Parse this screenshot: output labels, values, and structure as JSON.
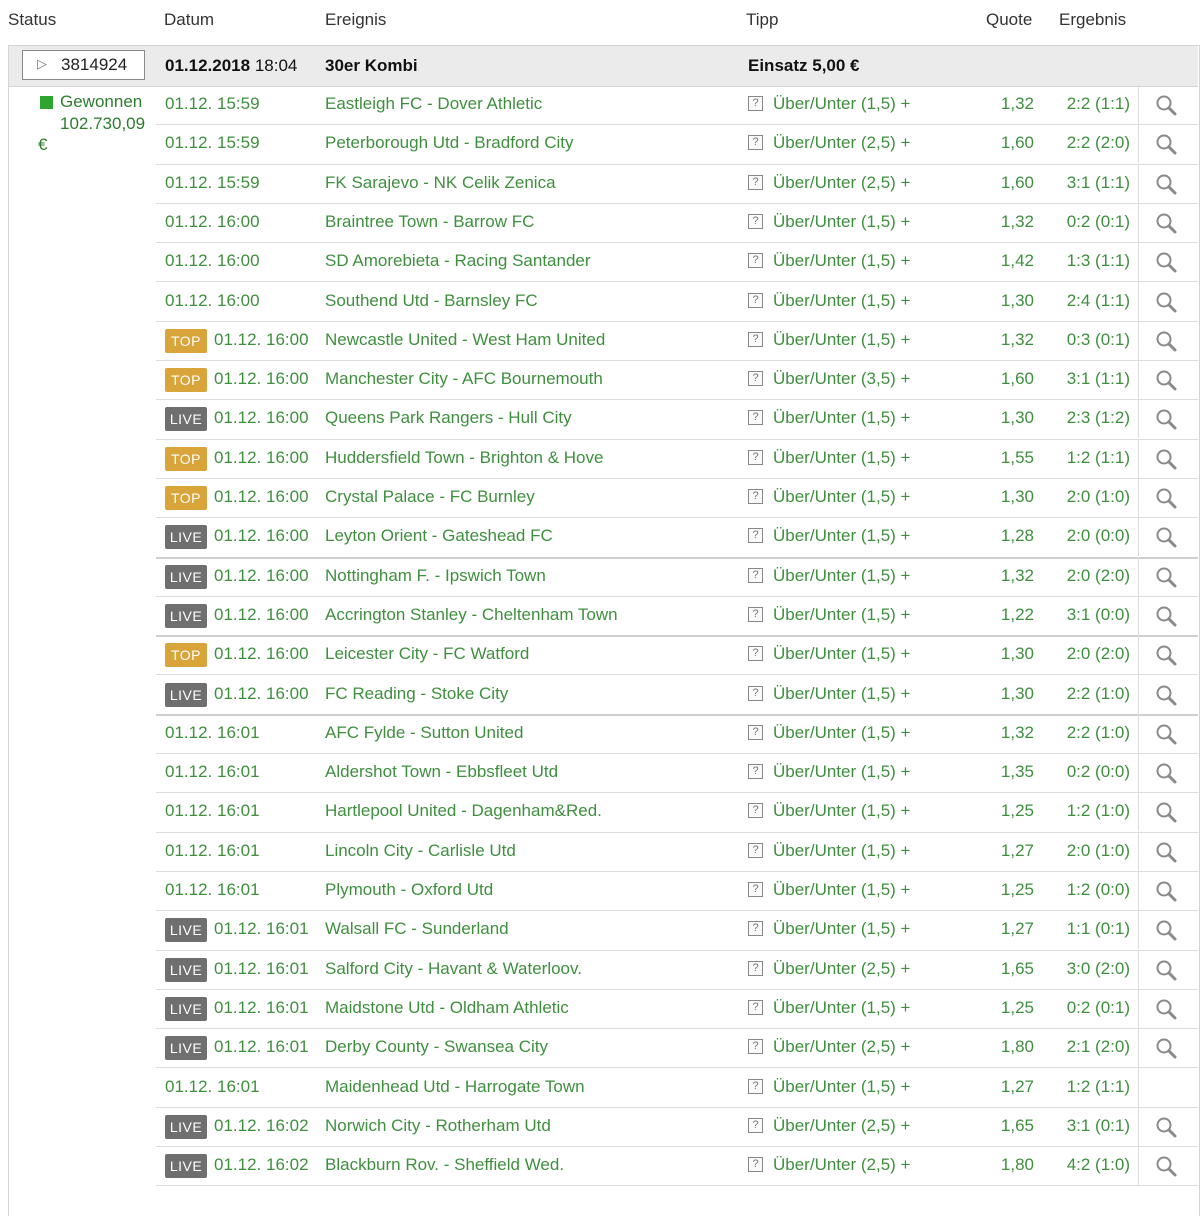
{
  "headers": {
    "status": "Status",
    "datum": "Datum",
    "ereignis": "Ereignis",
    "tipp": "Tipp",
    "quote": "Quote",
    "ergebnis": "Ergebnis"
  },
  "bet": {
    "id": "3814924",
    "date": "01.12.2018",
    "time": "18:04",
    "title": "30er Kombi",
    "stake": "Einsatz 5,00 €",
    "status": "Gewonnen",
    "payout": "102.730,09",
    "currency": "€"
  },
  "colors": {
    "accent_green": "#3f8f3f",
    "top_badge": "#d9a43a",
    "live_badge": "#6f6f6f",
    "status_won": "#2ea52e"
  },
  "rows": [
    {
      "badge": "",
      "date": "01.12. 15:59",
      "event": "Eastleigh FC - Dover Athletic",
      "tipp": "Über/Unter (1,5) +",
      "quote": "1,32",
      "result": "2:2 (1:1)",
      "search": true
    },
    {
      "badge": "",
      "date": "01.12. 15:59",
      "event": "Peterborough Utd - Bradford City",
      "tipp": "Über/Unter (2,5) +",
      "quote": "1,60",
      "result": "2:2 (2:0)",
      "search": true
    },
    {
      "badge": "",
      "date": "01.12. 15:59",
      "event": "FK Sarajevo - NK Celik Zenica",
      "tipp": "Über/Unter (2,5) +",
      "quote": "1,60",
      "result": "3:1 (1:1)",
      "search": true
    },
    {
      "badge": "",
      "date": "01.12. 16:00",
      "event": "Braintree Town - Barrow FC",
      "tipp": "Über/Unter (1,5) +",
      "quote": "1,32",
      "result": "0:2 (0:1)",
      "search": true
    },
    {
      "badge": "",
      "date": "01.12. 16:00",
      "event": "SD Amorebieta - Racing Santander",
      "tipp": "Über/Unter (1,5) +",
      "quote": "1,42",
      "result": "1:3 (1:1)",
      "search": true
    },
    {
      "badge": "",
      "date": "01.12. 16:00",
      "event": "Southend Utd - Barnsley FC",
      "tipp": "Über/Unter (1,5) +",
      "quote": "1,30",
      "result": "2:4 (1:1)",
      "search": true
    },
    {
      "badge": "TOP",
      "date": "01.12. 16:00",
      "event": "Newcastle United - West Ham United",
      "tipp": "Über/Unter (1,5) +",
      "quote": "1,32",
      "result": "0:3 (0:1)",
      "search": true
    },
    {
      "badge": "TOP",
      "date": "01.12. 16:00",
      "event": "Manchester City - AFC Bournemouth",
      "tipp": "Über/Unter (3,5) +",
      "quote": "1,60",
      "result": "3:1 (1:1)",
      "search": true
    },
    {
      "badge": "LIVE",
      "date": "01.12. 16:00",
      "event": "Queens Park Rangers - Hull City",
      "tipp": "Über/Unter (1,5) +",
      "quote": "1,30",
      "result": "2:3 (1:2)",
      "search": true
    },
    {
      "badge": "TOP",
      "date": "01.12. 16:00",
      "event": "Huddersfield Town - Brighton & Hove",
      "tipp": "Über/Unter (1,5) +",
      "quote": "1,55",
      "result": "1:2 (1:1)",
      "search": true
    },
    {
      "badge": "TOP",
      "date": "01.12. 16:00",
      "event": "Crystal Palace - FC Burnley",
      "tipp": "Über/Unter (1,5) +",
      "quote": "1,30",
      "result": "2:0 (1:0)",
      "search": true
    },
    {
      "badge": "LIVE",
      "date": "01.12. 16:00",
      "event": "Leyton Orient - Gateshead FC",
      "tipp": "Über/Unter (1,5) +",
      "quote": "1,28",
      "result": "2:0 (0:0)",
      "search": true
    },
    {
      "badge": "LIVE",
      "date": "01.12. 16:00",
      "event": "Nottingham F. - Ipswich Town",
      "tipp": "Über/Unter (1,5) +",
      "quote": "1,32",
      "result": "2:0 (2:0)",
      "search": true
    },
    {
      "badge": "LIVE",
      "date": "01.12. 16:00",
      "event": "Accrington Stanley - Cheltenham Town",
      "tipp": "Über/Unter (1,5) +",
      "quote": "1,22",
      "result": "3:1 (0:0)",
      "search": true
    },
    {
      "badge": "TOP",
      "date": "01.12. 16:00",
      "event": "Leicester City - FC Watford",
      "tipp": "Über/Unter (1,5) +",
      "quote": "1,30",
      "result": "2:0 (2:0)",
      "search": true
    },
    {
      "badge": "LIVE",
      "date": "01.12. 16:00",
      "event": "FC Reading - Stoke City",
      "tipp": "Über/Unter (1,5) +",
      "quote": "1,30",
      "result": "2:2 (1:0)",
      "search": true
    },
    {
      "badge": "",
      "date": "01.12. 16:01",
      "event": "AFC Fylde - Sutton United",
      "tipp": "Über/Unter (1,5) +",
      "quote": "1,32",
      "result": "2:2 (1:0)",
      "search": true
    },
    {
      "badge": "",
      "date": "01.12. 16:01",
      "event": "Aldershot Town - Ebbsfleet Utd",
      "tipp": "Über/Unter (1,5) +",
      "quote": "1,35",
      "result": "0:2 (0:0)",
      "search": true
    },
    {
      "badge": "",
      "date": "01.12. 16:01",
      "event": "Hartlepool United - Dagenham&Red.",
      "tipp": "Über/Unter (1,5) +",
      "quote": "1,25",
      "result": "1:2 (1:0)",
      "search": true
    },
    {
      "badge": "",
      "date": "01.12. 16:01",
      "event": "Lincoln City - Carlisle Utd",
      "tipp": "Über/Unter (1,5) +",
      "quote": "1,27",
      "result": "2:0 (1:0)",
      "search": true
    },
    {
      "badge": "",
      "date": "01.12. 16:01",
      "event": "Plymouth - Oxford Utd",
      "tipp": "Über/Unter (1,5) +",
      "quote": "1,25",
      "result": "1:2 (0:0)",
      "search": true
    },
    {
      "badge": "LIVE",
      "date": "01.12. 16:01",
      "event": "Walsall FC - Sunderland",
      "tipp": "Über/Unter (1,5) +",
      "quote": "1,27",
      "result": "1:1 (0:1)",
      "search": true
    },
    {
      "badge": "LIVE",
      "date": "01.12. 16:01",
      "event": "Salford City - Havant & Waterloov.",
      "tipp": "Über/Unter (2,5) +",
      "quote": "1,65",
      "result": "3:0 (2:0)",
      "search": true
    },
    {
      "badge": "LIVE",
      "date": "01.12. 16:01",
      "event": "Maidstone Utd - Oldham Athletic",
      "tipp": "Über/Unter (1,5) +",
      "quote": "1,25",
      "result": "0:2 (0:1)",
      "search": true
    },
    {
      "badge": "LIVE",
      "date": "01.12. 16:01",
      "event": "Derby County - Swansea City",
      "tipp": "Über/Unter (2,5) +",
      "quote": "1,80",
      "result": "2:1 (2:0)",
      "search": true
    },
    {
      "badge": "",
      "date": "01.12. 16:01",
      "event": "Maidenhead Utd - Harrogate Town",
      "tipp": "Über/Unter (1,5) +",
      "quote": "1,27",
      "result": "1:2 (1:1)",
      "search": false
    },
    {
      "badge": "LIVE",
      "date": "01.12. 16:02",
      "event": "Norwich City - Rotherham Utd",
      "tipp": "Über/Unter (2,5) +",
      "quote": "1,65",
      "result": "3:1 (0:1)",
      "search": true
    },
    {
      "badge": "LIVE",
      "date": "01.12. 16:02",
      "event": "Blackburn Rov. - Sheffield Wed.",
      "tipp": "Über/Unter (2,5) +",
      "quote": "1,80",
      "result": "4:2 (1:0)",
      "search": true
    }
  ]
}
